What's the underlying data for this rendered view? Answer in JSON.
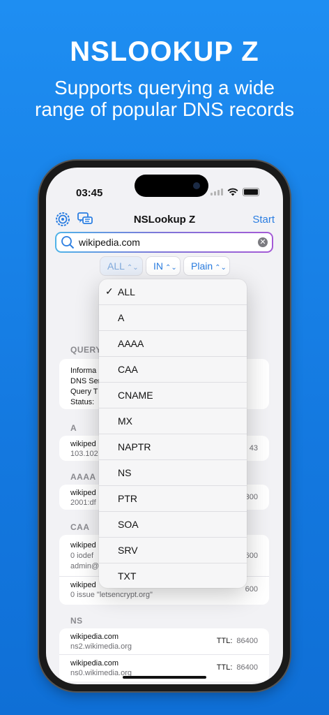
{
  "promo": {
    "title": "NSLOOKUP Z",
    "subtitle_line1": "Supports querying a wide",
    "subtitle_line2": "range of popular DNS records"
  },
  "status": {
    "time": "03:45"
  },
  "navbar": {
    "title": "NSLookup Z",
    "start": "Start",
    "left_icons": [
      "settings-icon",
      "chat-icon"
    ]
  },
  "search": {
    "value": "wikipedia.com"
  },
  "pickers": {
    "type": "ALL",
    "class": "IN",
    "format": "Plain"
  },
  "dropdown": {
    "selected": "ALL",
    "options": [
      "ALL",
      "A",
      "AAAA",
      "CAA",
      "CNAME",
      "MX",
      "NAPTR",
      "NS",
      "PTR",
      "SOA",
      "SRV",
      "TXT"
    ]
  },
  "sections": {
    "query": {
      "label": "QUERY",
      "lines": [
        "Informa",
        "DNS Ser",
        "Query T",
        "Status:"
      ]
    },
    "a": {
      "label": "A",
      "name": "wikiped",
      "value": "103.102",
      "ttl": "43"
    },
    "aaaa": {
      "label": "AAAA",
      "name": "wikiped",
      "value": "2001:df",
      "ttl": "300"
    },
    "caa": {
      "label": "CAA",
      "row1": {
        "name": "wikiped",
        "value": "0 iodef",
        "value2": "admin@",
        "ttl": "600"
      },
      "row2": {
        "name": "wikiped",
        "value": "0 issue \"letsencrypt.org\"",
        "ttl": "600"
      }
    },
    "ns": {
      "label": "NS",
      "ttl_label": "TTL:",
      "rows": [
        {
          "name": "wikipedia.com",
          "value": "ns2.wikimedia.org",
          "ttl": "86400"
        },
        {
          "name": "wikipedia.com",
          "value": "ns0.wikimedia.org",
          "ttl": "86400"
        }
      ]
    }
  },
  "colors": {
    "accent": "#2a7de1",
    "background": "#1e8ef2"
  }
}
